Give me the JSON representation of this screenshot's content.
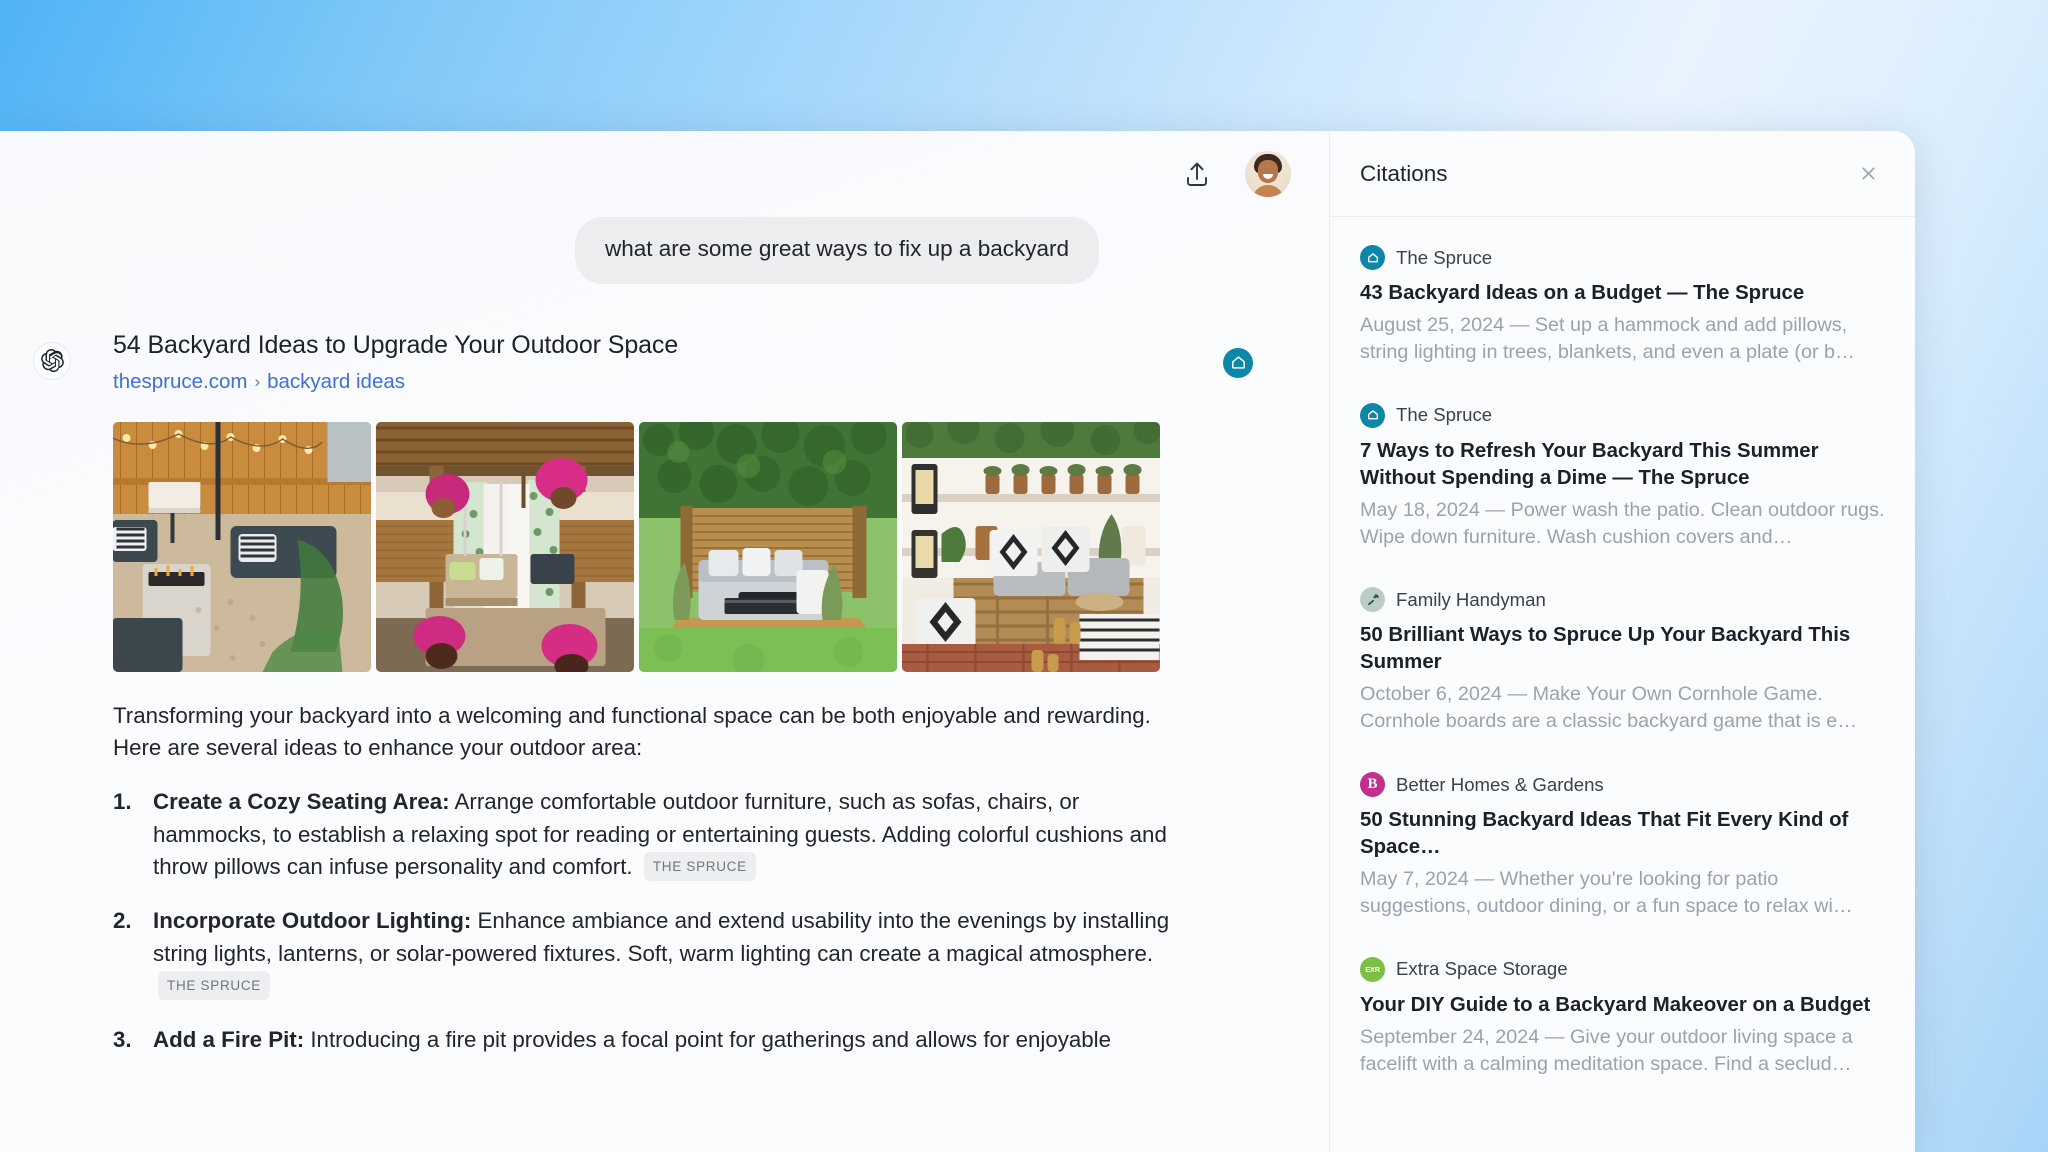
{
  "theme": {
    "accent_blue": "#3f6fd8",
    "spruce_teal": "#0d87a8",
    "bhg_magenta": "#c0308e",
    "exr_green": "#7bc043",
    "bubble_gray": "#ebedef",
    "panel_bg": "#fbfcfe"
  },
  "toolbar": {
    "share_icon": "share-upload-icon",
    "avatar_label": "user-avatar"
  },
  "conversation": {
    "user_query": "what are some great ways to fix up a backyard",
    "assistant_icon": "openai-logo-icon",
    "result": {
      "title": "54 Backyard Ideas to Upgrade Your Outdoor Space",
      "domain": "thespruce.com",
      "breadcrumb_separator": "›",
      "breadcrumb_path": "backyard ideas",
      "source_badge_icon": "home-icon"
    },
    "thumbnails": [
      {
        "name": "thumb-fire-pit-patio"
      },
      {
        "name": "thumb-pergola-swing"
      },
      {
        "name": "thumb-corner-sofa-deck"
      },
      {
        "name": "thumb-pallet-lounge"
      }
    ],
    "intro": "Transforming your backyard into a welcoming and functional space can be both enjoyable and rewarding. Here are several ideas to enhance your outdoor area:",
    "items": [
      {
        "number": "1.",
        "lead": "Create a Cozy Seating Area:",
        "body": "Arrange comfortable outdoor furniture, such as sofas, chairs, or hammocks, to establish a relaxing spot for reading or entertaining guests. Adding colorful cushions and throw pillows can infuse personality and comfort.",
        "chip": "THE SPRUCE"
      },
      {
        "number": "2.",
        "lead": "Incorporate Outdoor Lighting:",
        "body": "Enhance ambiance and extend usability into the evenings by installing string lights, lanterns, or solar-powered fixtures. Soft, warm lighting can create a magical atmosphere.",
        "chip": "THE SPRUCE"
      },
      {
        "number": "3.",
        "lead": "Add a Fire Pit:",
        "body": "Introducing a fire pit provides a focal point for gatherings and allows for enjoyable",
        "chip": ""
      }
    ]
  },
  "citations_panel": {
    "title": "Citations",
    "close_icon": "close-icon",
    "items": [
      {
        "source": "The Spruce",
        "favicon_kind": "spruce",
        "favicon_text": "",
        "favicon_icon": "home-icon",
        "title": "43 Backyard Ideas on a Budget — The Spruce",
        "snippet": "August 25, 2024 — Set up a hammock and add pillows, string lighting in trees, blankets, and even a plate (or b…"
      },
      {
        "source": "The Spruce",
        "favicon_kind": "spruce",
        "favicon_text": "",
        "favicon_icon": "home-icon",
        "title": "7 Ways to Refresh Your Backyard This Summer Without Spending a Dime — The Spruce",
        "snippet": "May 18, 2024 — Power wash the patio. Clean outdoor rugs. Wipe down furniture. Wash cushion covers and…"
      },
      {
        "source": "Family Handyman",
        "favicon_kind": "handyman",
        "favicon_text": "",
        "favicon_icon": "hammer-icon",
        "title": "50 Brilliant Ways to Spruce Up Your Backyard This Summer",
        "snippet": "October 6, 2024 — Make Your Own Cornhole Game. Cornhole boards are a classic backyard game that is e…"
      },
      {
        "source": "Better Homes & Gardens",
        "favicon_kind": "bhg",
        "favicon_text": "B",
        "favicon_icon": "letter-b-icon",
        "title": "50 Stunning Backyard Ideas That Fit Every Kind of Space…",
        "snippet": "May 7, 2024 — Whether you're looking for patio suggestions, outdoor dining, or a fun space to relax wi…"
      },
      {
        "source": "Extra Space Storage",
        "favicon_kind": "exr",
        "favicon_text": "EXR",
        "favicon_icon": "exr-logo-icon",
        "title": "Your DIY Guide to a Backyard Makeover on a Budget",
        "snippet": "September 24, 2024 — Give your outdoor living space a facelift with a calming meditation space. Find a seclud…"
      }
    ]
  }
}
